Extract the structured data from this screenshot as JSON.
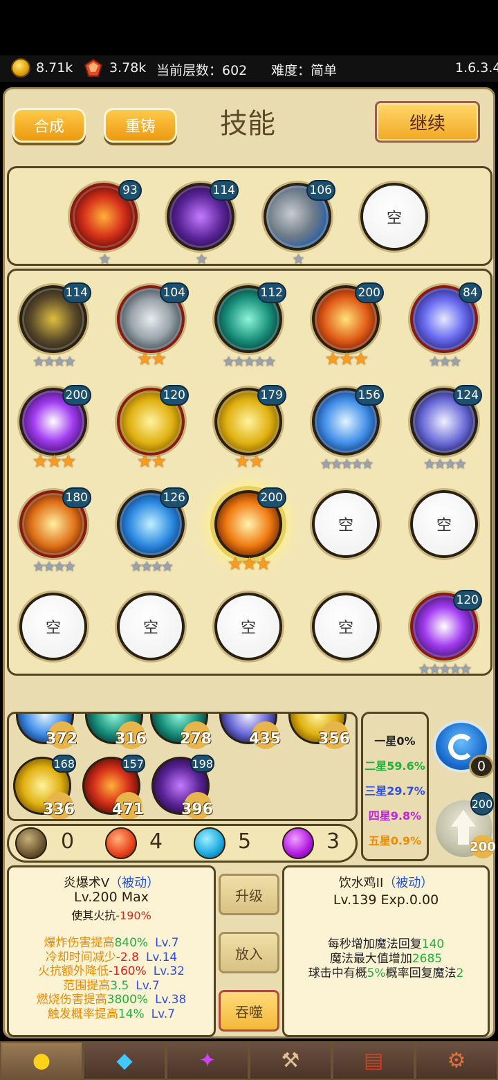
{
  "topbar": {
    "gold": "8.71k",
    "crystal": "3.78k",
    "floor": "当前层数：602",
    "difficulty": "难度：简单",
    "version": "1.6.3.4"
  },
  "header": {
    "title": "技能",
    "btn_synth": "合成",
    "btn_recast": "重铸",
    "btn_continue": "继续"
  },
  "equipped": [
    {
      "icon": "fire-nova-icon",
      "level": "93",
      "stars": 1,
      "gold": false
    },
    {
      "icon": "void-orb-icon",
      "level": "114",
      "stars": 1,
      "gold": false
    },
    {
      "icon": "rock-fall-icon",
      "level": "106",
      "stars": 1,
      "gold": false
    },
    {
      "empty": true,
      "label": "空"
    }
  ],
  "grid": [
    {
      "icon": "plague-icon",
      "level": "114",
      "stars": 4,
      "gold": false
    },
    {
      "icon": "stone-armor-icon",
      "level": "104",
      "stars": 2,
      "gold": true
    },
    {
      "icon": "wind-slash-icon",
      "level": "112",
      "stars": 5,
      "gold": false
    },
    {
      "icon": "lava-icon",
      "level": "200",
      "stars": 3,
      "gold": true
    },
    {
      "icon": "storm-icon",
      "level": "84",
      "stars": 3,
      "gold": false
    },
    {
      "icon": "thunder-icon",
      "level": "200",
      "stars": 3,
      "gold": true
    },
    {
      "icon": "gold-card-icon",
      "level": "120",
      "stars": 2,
      "gold": true
    },
    {
      "icon": "gold-card-icon",
      "level": "179",
      "stars": 2,
      "gold": true
    },
    {
      "icon": "ice-spear-icon",
      "level": "156",
      "stars": 5,
      "gold": false
    },
    {
      "icon": "spirit-deer-icon",
      "level": "124",
      "stars": 4,
      "gold": false
    },
    {
      "icon": "flame-deer-icon",
      "level": "180",
      "stars": 4,
      "gold": false
    },
    {
      "icon": "water-icon",
      "level": "126",
      "stars": 4,
      "gold": false
    },
    {
      "icon": "meteor-icon",
      "level": "200",
      "stars": 3,
      "gold": true,
      "glow": true
    },
    {
      "empty": true,
      "label": "空"
    },
    {
      "empty": true,
      "label": "空"
    },
    {
      "empty": true,
      "label": "空"
    },
    {
      "empty": true,
      "label": "空"
    },
    {
      "empty": true,
      "label": "空"
    },
    {
      "empty": true,
      "label": "空"
    },
    {
      "icon": "thunder-icon",
      "level": "120",
      "stars": 5,
      "gold": false
    }
  ],
  "inventory": {
    "row1_costs": [
      "372",
      "316",
      "278",
      "435",
      "356"
    ],
    "row2": [
      {
        "icon": "golden-beast-icon",
        "level": "168",
        "cost": "336"
      },
      {
        "icon": "fire-glyph-icon",
        "level": "157",
        "cost": "471"
      },
      {
        "icon": "arcane-star-icon",
        "level": "198",
        "cost": "396"
      }
    ]
  },
  "rates": {
    "one": "一星0%",
    "two": "二星59.6%",
    "three": "三星29.7%",
    "four": "四星9.8%",
    "five": "五星0.9%",
    "colors": {
      "one": "#222222",
      "two": "#19b43a",
      "three": "#2f4fe8",
      "four": "#c020e0",
      "five": "#f08a00"
    }
  },
  "side": {
    "refresh_count": "0",
    "upgrade_level": "200",
    "upgrade_cost": "200"
  },
  "orbs": [
    {
      "name": "earth",
      "count": "0"
    },
    {
      "name": "fire",
      "count": "4"
    },
    {
      "name": "water",
      "count": "5"
    },
    {
      "name": "arcane",
      "count": "3"
    }
  ],
  "left_info": {
    "title": "炎爆术V",
    "tag": "（被动）",
    "level": "Lv.200 Max",
    "effect_prefix": "使其火抗",
    "effect_value": "-190%",
    "stats": [
      {
        "label": "爆炸伤害提高",
        "value": "840%",
        "lv": "Lv.7"
      },
      {
        "label": "冷却时间减少",
        "value": "-2.8",
        "lv": "Lv.14"
      },
      {
        "label": "火抗额外降低",
        "value": "-160%",
        "lv": "Lv.32"
      },
      {
        "label": "范围提高",
        "value": "3.5",
        "lv": "Lv.7"
      },
      {
        "label": "燃烧伤害提高",
        "value": "3800%",
        "lv": "Lv.38"
      },
      {
        "label": "触发概率提高",
        "value": "14%",
        "lv": "Lv.7"
      }
    ]
  },
  "middle_buttons": {
    "upgrade": "升级",
    "place": "放入",
    "devour": "吞噬"
  },
  "right_info": {
    "title": "饮水鸡II",
    "tag": "（被动）",
    "level": "Lv.139 Exp.0.00",
    "l1a": "每秒增加魔法回复",
    "l1b": "140",
    "l2a": "魔法最大值增加",
    "l2b": "2685",
    "l3a": "球击中有概",
    "l3b": "5%",
    "l3c": "概率回复魔法",
    "l3d": "2"
  },
  "nav": [
    {
      "icon": "hero-icon"
    },
    {
      "icon": "crystal-icon"
    },
    {
      "icon": "rune-icon"
    },
    {
      "icon": "forge-icon"
    },
    {
      "icon": "book-icon"
    },
    {
      "icon": "settings-gear-icon"
    }
  ]
}
